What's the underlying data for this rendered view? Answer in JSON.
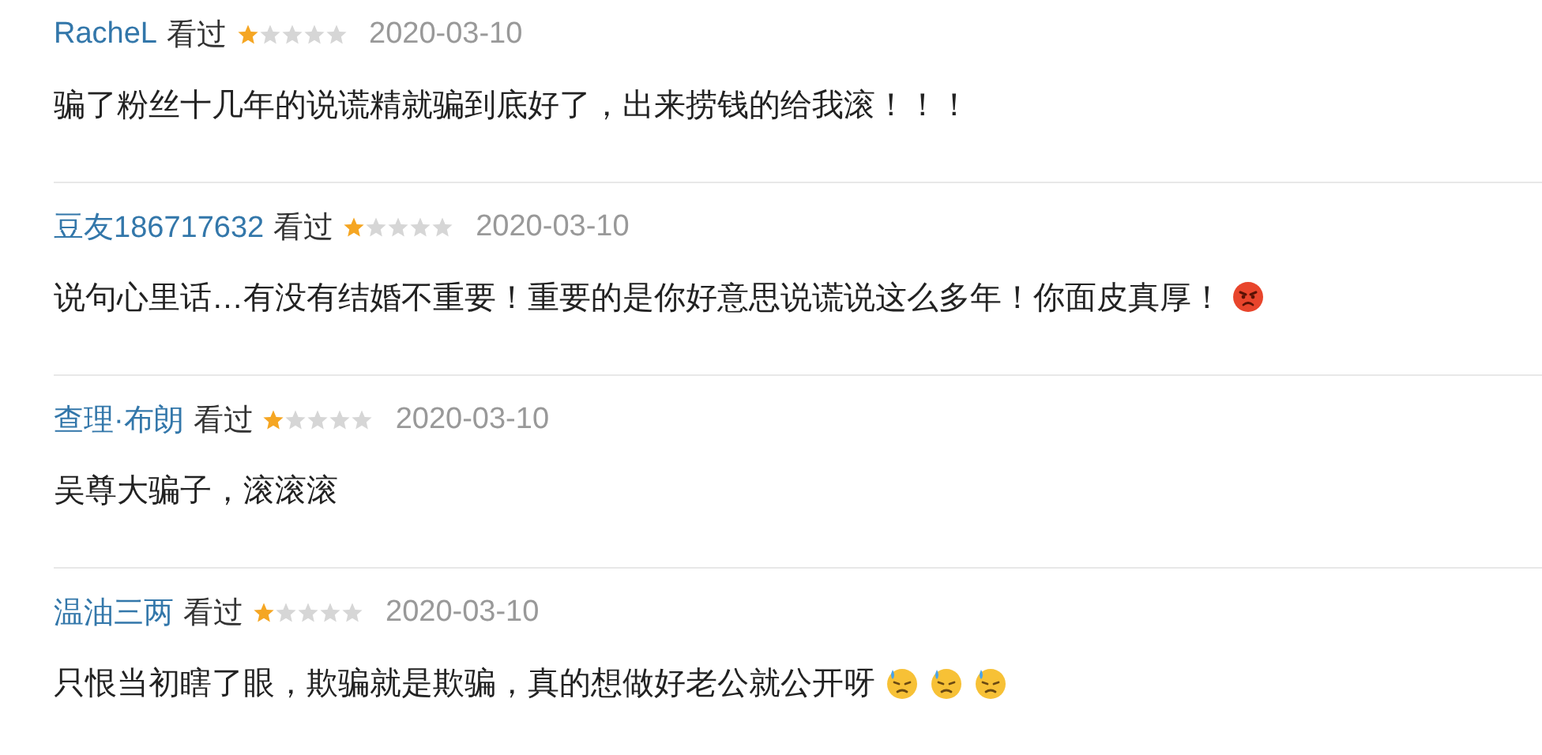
{
  "comments": [
    {
      "user": "RacheL",
      "status": "看过",
      "stars": 1,
      "date": "2020-03-10",
      "text": "骗了粉丝十几年的说谎精就骗到底好了，出来捞钱的给我滚！！！"
    },
    {
      "user": "豆友186717632",
      "status": "看过",
      "stars": 1,
      "date": "2020-03-10",
      "text": "说句心里话…有没有结婚不重要！重要的是你好意思说谎说这么多年！你面皮真厚！",
      "trailing_icons": [
        {
          "kind": "angry"
        }
      ]
    },
    {
      "user": "查理·布朗",
      "status": "看过",
      "stars": 1,
      "date": "2020-03-10",
      "text": "吴尊大骗子，滚滚滚"
    },
    {
      "user": "温油三两",
      "status": "看过",
      "stars": 1,
      "date": "2020-03-10",
      "text": "只恨当初瞎了眼，欺骗就是欺骗，真的想做好老公就公开呀",
      "trailing_icons": [
        {
          "kind": "sweat"
        },
        {
          "kind": "sweat"
        },
        {
          "kind": "sweat"
        }
      ]
    }
  ]
}
